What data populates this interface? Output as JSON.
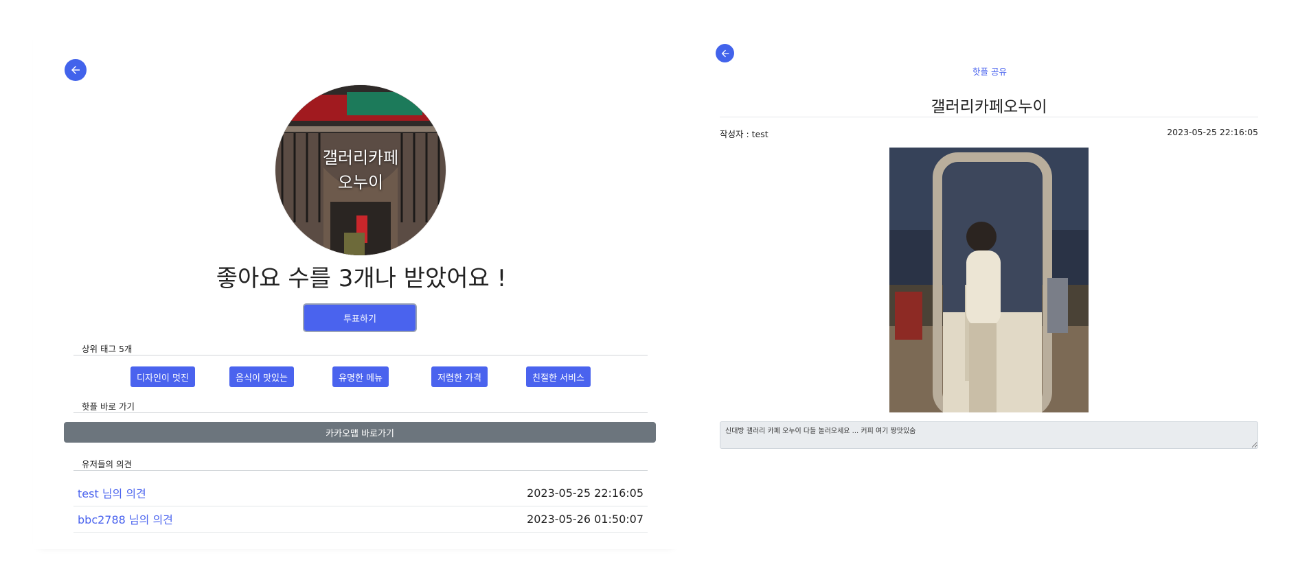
{
  "left": {
    "back_icon": "arrow-left-icon",
    "place_name_line1": "갤러리카페",
    "place_name_line2": "오누이",
    "likes_text": "좋아요 수를 3개나 받았어요 !",
    "vote_button": "투표하기",
    "top_tags_label": "상위 태그 5개",
    "tags": [
      "디자인이 멋진",
      "음식이 맛있는",
      "유명한 메뉴",
      "저렴한 가격",
      "친절한 서비스"
    ],
    "shortcut_label": "핫플 바로 가기",
    "kakao_button": "카카오맵 바로가기",
    "opinions_label": "유저들의 의견",
    "opinions": [
      {
        "user": "test 님의 의견",
        "date": "2023-05-25 22:16:05"
      },
      {
        "user": "bbc2788 님의 의견",
        "date": "2023-05-26 01:50:07"
      }
    ]
  },
  "right": {
    "back_icon": "arrow-left-icon",
    "share_link": "핫플 공유",
    "title": "갤러리카페오누이",
    "author": "작성자 : test",
    "date": "2023-05-25 22:16:05",
    "comment": "신대방 갤러리 카페 오누이 다들 놀러오세요 ... 커피 여기 짱맛있숨"
  },
  "colors": {
    "primary": "#4a63ee",
    "secondary": "#6c757d"
  }
}
